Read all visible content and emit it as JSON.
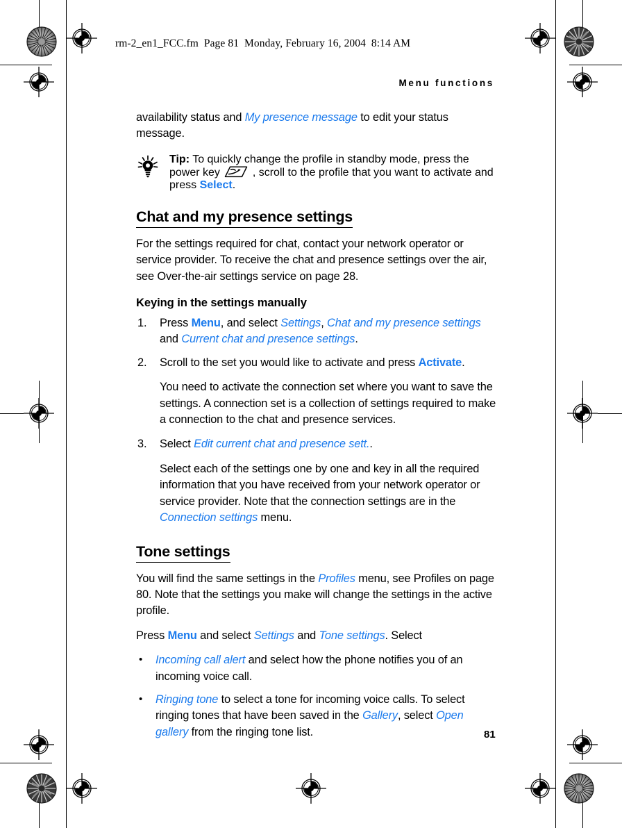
{
  "proof_header": {
    "text": "rm-2_en1_FCC.fm  Page 81  Monday, February 16, 2004  8:14 AM"
  },
  "running_head": {
    "text": "Menu functions"
  },
  "page_number": "81",
  "colors": {
    "link_blue": "#1a7aed",
    "text_black": "#000000",
    "page_background": "#ffffff"
  },
  "content": {
    "intro_paragraph": {
      "part1": "availability status and ",
      "menu_item": "My presence message",
      "part2": " to edit your status message."
    },
    "tip": {
      "icon": "lightbulb-icon",
      "label": "Tip:",
      "part1": " To quickly change the profile in standby mode, press the power key ",
      "key_icon": "power-key-icon",
      "part2": " , scroll to the profile that you want to activate and press ",
      "command": "Select",
      "part3": "."
    },
    "section_chat": {
      "heading": "Chat and my presence settings",
      "paragraph": "For the settings required for chat, contact your network operator or service provider. To receive the chat and presence settings over the air, see Over-the-air settings service on page 28.",
      "subheading": "Keying in the settings manually",
      "steps": [
        {
          "number": "1.",
          "part1": "Press ",
          "command": "Menu",
          "part2": ", and select ",
          "menu1": "Settings",
          "part3": ", ",
          "menu2": "Chat and my presence settings",
          "part4": " and ",
          "menu3": "Current chat and presence settings",
          "part5": "."
        },
        {
          "number": "2.",
          "part1": "Scroll to the set you would like to activate and press ",
          "command": "Activate",
          "part2": "."
        },
        {
          "number": "3.",
          "part1": "Select ",
          "menu1": "Edit current chat and presence sett.",
          "part2": "."
        }
      ],
      "step2_note": "You need to activate the connection set where you want to save the settings. A connection set is a collection of settings required to make a connection to the chat and presence services.",
      "step3_note": {
        "part1": "Select each of the settings one by one and key in all the required information that you have received from your network operator or service provider. Note that the connection settings are in the ",
        "menu1": "Connection settings",
        "part2": " menu."
      }
    },
    "section_tone": {
      "heading": "Tone settings",
      "paragraph": {
        "part1": "You will find the same settings in the ",
        "menu1": "Profiles",
        "part2": " menu, see Profiles on page 80. Note that the settings you make will change the settings in the active profile."
      },
      "press_line": {
        "part1": "Press ",
        "command": "Menu",
        "part2": " and select ",
        "menu1": "Settings",
        "part3": " and ",
        "menu2": "Tone settings",
        "part4": ". Select"
      },
      "bullets": [
        {
          "marker": "•",
          "menu1": "Incoming call alert",
          "part1": " and select how the phone notifies you of an incoming voice call."
        },
        {
          "marker": "•",
          "menu1": "Ringing tone",
          "part1": " to select a tone for incoming voice calls. To select ringing tones that have been saved in the ",
          "menu2": "Gallery",
          "part2": ", select ",
          "menu3": "Open gallery",
          "part3": " from the ringing tone list."
        }
      ]
    }
  }
}
